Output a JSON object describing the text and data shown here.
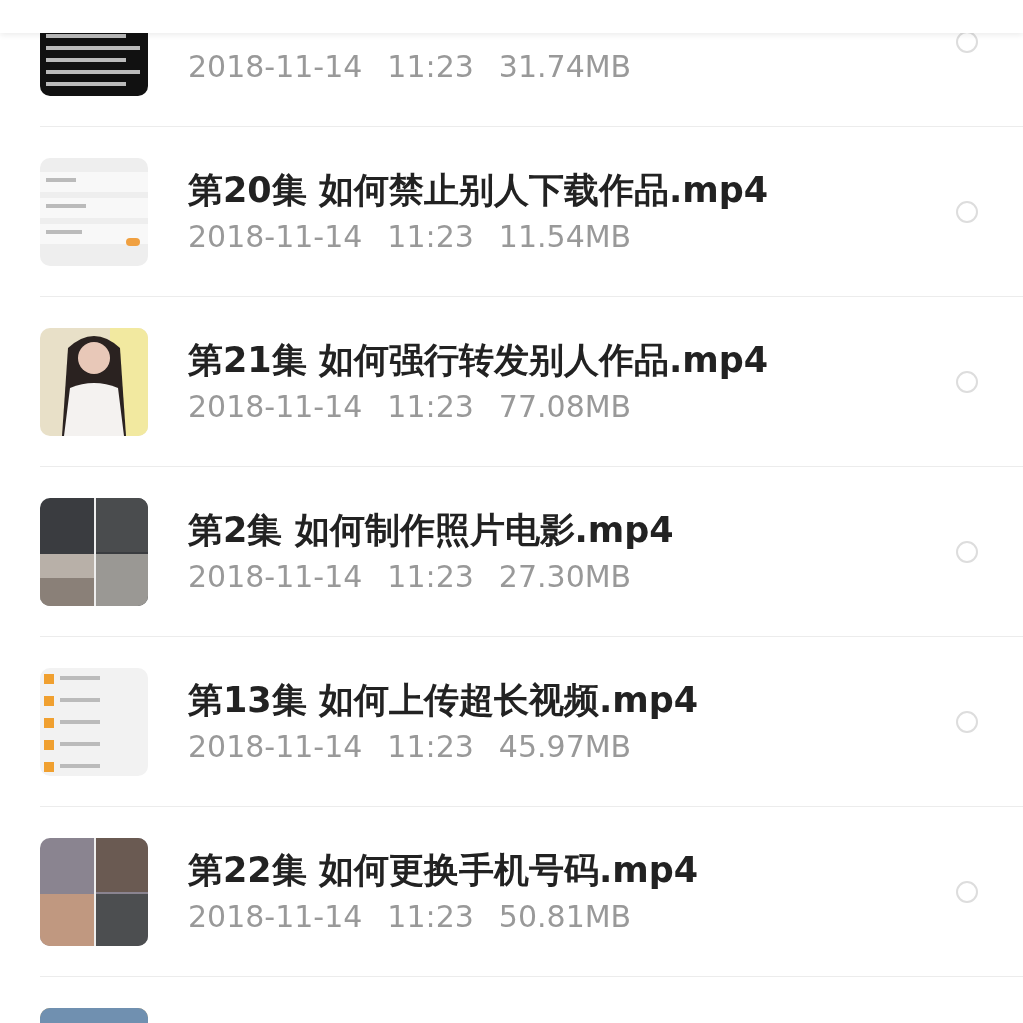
{
  "files": [
    {
      "kind": "file",
      "date": "2018-11-14",
      "time": "11:23",
      "size": "31.74MB",
      "selected": false
    },
    {
      "kind": "file",
      "title": "第20集 如何禁止别人下载作品.mp4",
      "date": "2018-11-14",
      "time": "11:23",
      "size": "11.54MB",
      "selected": false
    },
    {
      "kind": "file",
      "title": "第21集 如何强行转发别人作品.mp4",
      "date": "2018-11-14",
      "time": "11:23",
      "size": "77.08MB",
      "selected": false
    },
    {
      "kind": "file",
      "title": "第2集 如何制作照片电影.mp4",
      "date": "2018-11-14",
      "time": "11:23",
      "size": "27.30MB",
      "selected": false
    },
    {
      "kind": "file",
      "title": "第13集 如何上传超长视频.mp4",
      "date": "2018-11-14",
      "time": "11:23",
      "size": "45.97MB",
      "selected": false
    },
    {
      "kind": "file",
      "title": "第22集 如何更换手机号码.mp4",
      "date": "2018-11-14",
      "time": "11:23",
      "size": "50.81MB",
      "selected": false
    },
    {
      "kind": "picture"
    }
  ]
}
